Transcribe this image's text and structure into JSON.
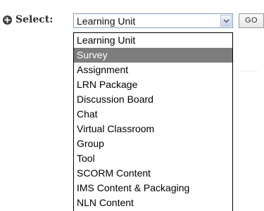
{
  "selector": {
    "label": "Select:",
    "current_value": "Learning Unit",
    "go_label": "GO"
  },
  "dropdown": {
    "options": [
      {
        "label": "Learning Unit",
        "selected": false
      },
      {
        "label": "Survey",
        "selected": true
      },
      {
        "label": "Assignment",
        "selected": false
      },
      {
        "label": "LRN Package",
        "selected": false
      },
      {
        "label": "Discussion Board",
        "selected": false
      },
      {
        "label": "Chat",
        "selected": false
      },
      {
        "label": "Virtual Classroom",
        "selected": false
      },
      {
        "label": "Group",
        "selected": false
      },
      {
        "label": "Tool",
        "selected": false
      },
      {
        "label": "SCORM Content",
        "selected": false
      },
      {
        "label": "IMS Content & Packaging",
        "selected": false
      },
      {
        "label": "NLN Content",
        "selected": false
      }
    ]
  },
  "icons": {
    "add": "plus-circle-icon",
    "dropdown_arrow": "chevron-down-icon"
  },
  "colors": {
    "highlight_bg": "#7d7d7d",
    "highlight_text": "#ffffff",
    "select_border": "#7f9db9"
  }
}
